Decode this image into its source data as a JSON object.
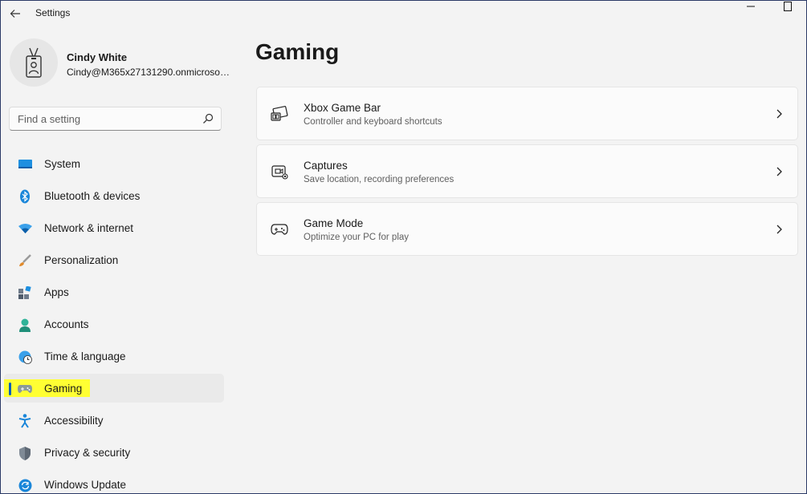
{
  "app": {
    "title": "Settings"
  },
  "window_controls": {
    "minimize": "minimize-icon",
    "maximize": "maximize-icon"
  },
  "profile": {
    "name": "Cindy White",
    "email": "Cindy@M365x27131290.onmicrosoft..."
  },
  "search": {
    "placeholder": "Find a setting",
    "value": ""
  },
  "sidebar": {
    "items": [
      {
        "label": "System",
        "icon": "system-icon"
      },
      {
        "label": "Bluetooth & devices",
        "icon": "bluetooth-icon"
      },
      {
        "label": "Network & internet",
        "icon": "wifi-icon"
      },
      {
        "label": "Personalization",
        "icon": "brush-icon"
      },
      {
        "label": "Apps",
        "icon": "apps-icon"
      },
      {
        "label": "Accounts",
        "icon": "person-icon"
      },
      {
        "label": "Time & language",
        "icon": "globe-clock-icon"
      },
      {
        "label": "Gaming",
        "icon": "controller-icon",
        "selected": true
      },
      {
        "label": "Accessibility",
        "icon": "accessibility-icon"
      },
      {
        "label": "Privacy & security",
        "icon": "shield-icon"
      },
      {
        "label": "Windows Update",
        "icon": "update-icon"
      }
    ]
  },
  "main": {
    "title": "Gaming",
    "cards": [
      {
        "title": "Xbox Game Bar",
        "description": "Controller and keyboard shortcuts",
        "icon": "game-bar-icon"
      },
      {
        "title": "Captures",
        "description": "Save location, recording preferences",
        "icon": "capture-icon"
      },
      {
        "title": "Game Mode",
        "description": "Optimize your PC for play",
        "icon": "gamepad-icon"
      }
    ]
  },
  "colors": {
    "accent": "#005fb8",
    "highlight": "#ffff00",
    "background": "#f3f3f3",
    "card": "#fbfbfb"
  }
}
